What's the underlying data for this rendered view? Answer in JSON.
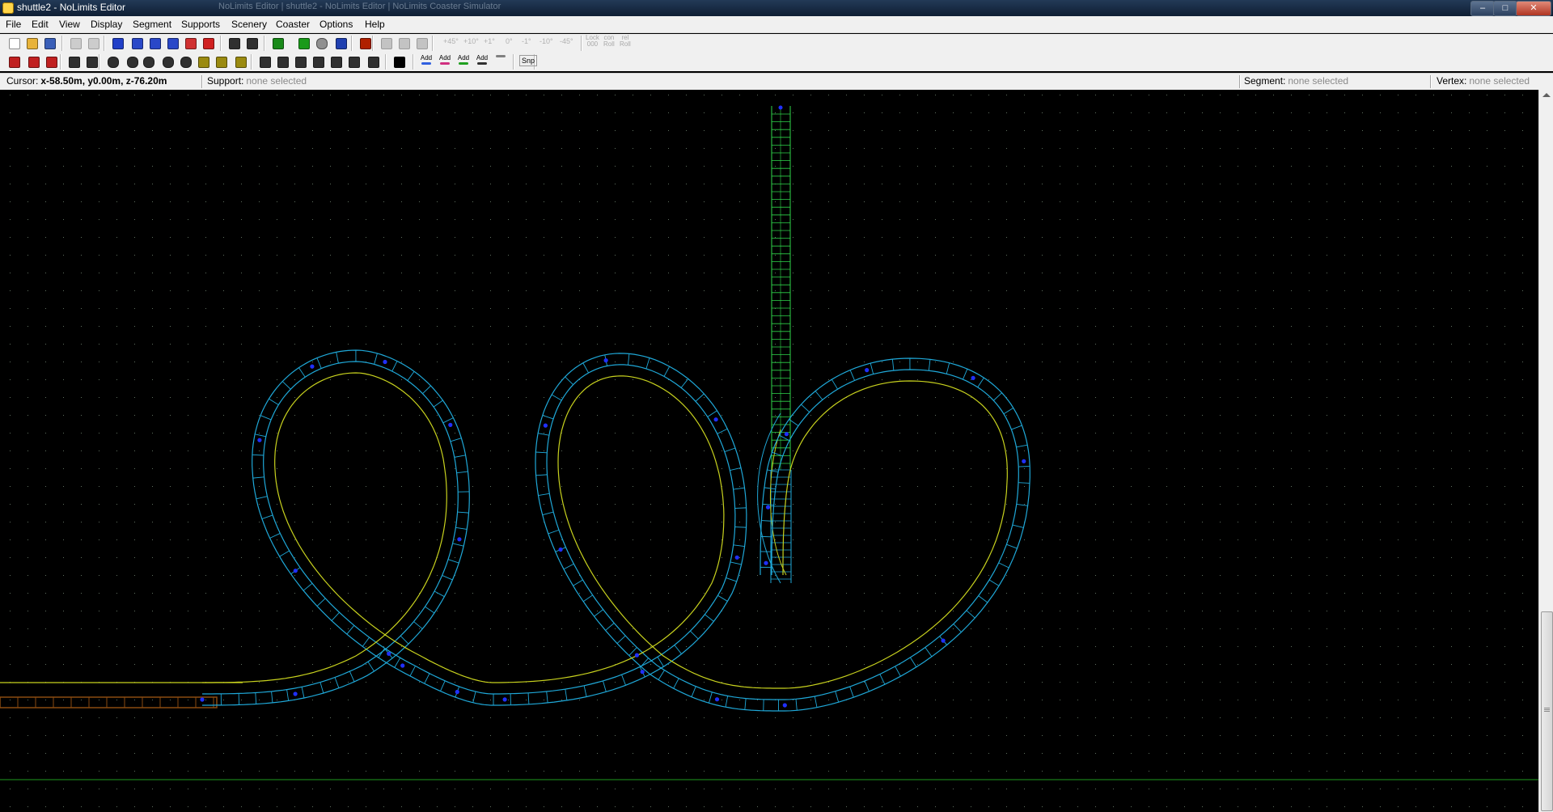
{
  "window": {
    "title": "shuttle2 - NoLimits Editor",
    "background_tabs": "NoLimits Editor   |   shuttle2 - NoLimits Editor   |   NoLimits Coaster Simulator",
    "controls": {
      "minimize": "–",
      "maximize": "□",
      "close": "✕"
    }
  },
  "menubar": {
    "items": [
      {
        "key": "file",
        "label": "File"
      },
      {
        "key": "edit",
        "label": "Edit"
      },
      {
        "key": "view",
        "label": "View"
      },
      {
        "key": "display",
        "label": "Display"
      },
      {
        "key": "segment",
        "label": "Segment"
      },
      {
        "key": "supports",
        "label": "Supports"
      },
      {
        "key": "scenery",
        "label": "Scenery"
      },
      {
        "key": "coaster",
        "label": "Coaster"
      },
      {
        "key": "options",
        "label": "Options"
      },
      {
        "key": "help",
        "label": "Help"
      }
    ]
  },
  "toolbar1": {
    "buttons": [
      {
        "name": "new-file-icon",
        "color": "#ffffff"
      },
      {
        "name": "open-folder-icon",
        "color": "#e8b33a"
      },
      {
        "name": "save-icon",
        "color": "#3a5fb8"
      },
      {
        "name": "undo-icon",
        "color": "#b0b0b0"
      },
      {
        "name": "redo-icon",
        "color": "#b0b0b0"
      },
      {
        "name": "track-grid-icon",
        "color": "#2240c8"
      },
      {
        "name": "wave-track-icon",
        "color": "#2a48c8"
      },
      {
        "name": "dip-track-icon",
        "color": "#2a48c8"
      },
      {
        "name": "coaster-car-icon",
        "color": "#2a48c8"
      },
      {
        "name": "station-icon",
        "color": "#d03030"
      },
      {
        "name": "3d-view-icon",
        "color": "#d02020"
      },
      {
        "name": "add-node-icon",
        "color": "#303030"
      },
      {
        "name": "remove-node-icon",
        "color": "#303030"
      },
      {
        "name": "terrain-map-icon",
        "color": "#1a8a1a"
      },
      {
        "name": "traffic-light-icon",
        "color": "#1a9a1a"
      },
      {
        "name": "sphere-icon",
        "color": "#909090"
      },
      {
        "name": "tent-icon",
        "color": "#2040b0"
      },
      {
        "name": "film-icon",
        "color": "#b02000"
      },
      {
        "name": "panel-icon",
        "color": "#a0a0a0"
      },
      {
        "name": "gray-block-icon",
        "color": "#a0a0a0"
      },
      {
        "name": "align-icon",
        "color": "#a0a0a0"
      }
    ],
    "roll_buttons": [
      "+45°",
      "+10°",
      "+1°",
      "0°",
      "-1°",
      "-10°",
      "-45°"
    ],
    "roll_labels": [
      [
        "Lock",
        "000"
      ],
      [
        "con",
        "Roll"
      ],
      [
        "rel",
        "Roll"
      ]
    ]
  },
  "toolbar2": {
    "buttons": [
      {
        "name": "pencil-track-icon",
        "color": "#c02020"
      },
      {
        "name": "split-icon",
        "color": "#c02020"
      },
      {
        "name": "merge-icon",
        "color": "#c02020"
      },
      {
        "name": "ruler-icon",
        "color": "#303030"
      },
      {
        "name": "ruler-alt-icon",
        "color": "#303030"
      },
      {
        "name": "pillar-round-icon",
        "color": "#303030"
      },
      {
        "name": "pillar-oval-icon",
        "color": "#303030"
      },
      {
        "name": "cylinder-icon",
        "color": "#303030"
      },
      {
        "name": "cylinder-wide-icon",
        "color": "#303030"
      },
      {
        "name": "cylinder-flat-icon",
        "color": "#303030"
      },
      {
        "name": "footer-plate-icon",
        "color": "#9a8a10"
      },
      {
        "name": "footer-block-icon",
        "color": "#9a8a10"
      },
      {
        "name": "measure-icon",
        "color": "#9a8a10"
      },
      {
        "name": "support-leg-icon",
        "color": "#303030"
      },
      {
        "name": "support-frame-icon",
        "color": "#303030"
      },
      {
        "name": "support-arch-icon",
        "color": "#303030"
      },
      {
        "name": "support-bent-icon",
        "color": "#303030"
      },
      {
        "name": "support-angle-icon",
        "color": "#303030"
      },
      {
        "name": "support-split-icon",
        "color": "#303030"
      },
      {
        "name": "support-end-icon",
        "color": "#303030"
      },
      {
        "name": "select-pointer-icon",
        "color": "#000000"
      }
    ],
    "add_buttons": [
      {
        "label": "Add",
        "color": "#3060e0"
      },
      {
        "label": "Add",
        "color": "#d03080"
      },
      {
        "label": "Add",
        "color": "#20a020"
      },
      {
        "label": "Add",
        "color": "#303030"
      },
      {
        "label": "",
        "color": "#808080"
      }
    ],
    "snap_label": "Snp"
  },
  "statusbar": {
    "cursor_label": "Cursor:",
    "cursor_value": "x-58.50m, y0.00m, z-76.20m",
    "support_label": "Support:",
    "support_value": "none selected",
    "segment_label": "Segment:",
    "segment_value": "none selected",
    "vertex_label": "Vertex:",
    "vertex_value": "none selected"
  },
  "viewport": {
    "background": "#000000",
    "grid_dot_color": "#5f6f5f",
    "ground_line_color": "#1f9a1f",
    "track_color": "#1fa8d8",
    "centerline_color": "#c8d21e",
    "vertex_color": "#2030ff",
    "station_color": "#8a4a10",
    "launch_tower_color": "#2fd64a"
  }
}
